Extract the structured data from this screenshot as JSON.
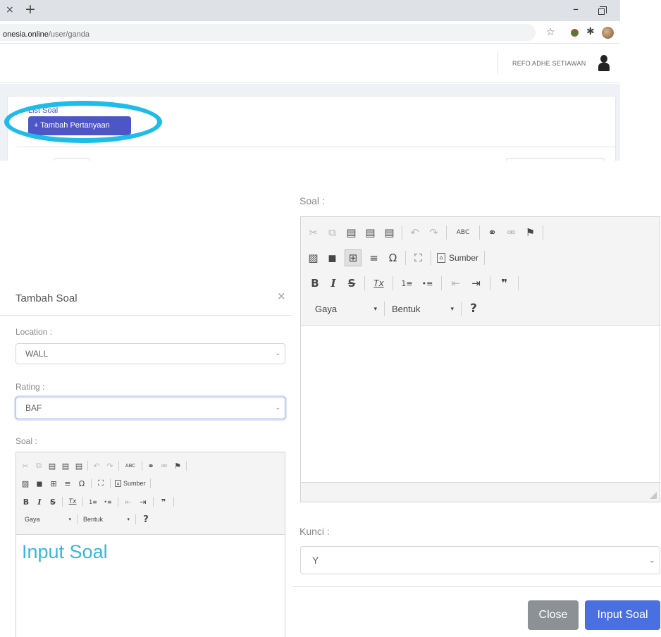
{
  "browser": {
    "url_host": "onesia.online",
    "url_path": "/user/ganda",
    "tab_close_glyph": "×",
    "new_tab_glyph": "+",
    "minimize_glyph": "–"
  },
  "header": {
    "username": "REFO ADHE SETIAWAN"
  },
  "list_card": {
    "title": "List Soal",
    "add_button_label": "+ Tambah Pertanyaan"
  },
  "modal": {
    "title": "Tambah Soal",
    "close_glyph": "×",
    "location_label": "Location :",
    "location_value": "WALL",
    "rating_label": "Rating :",
    "rating_value": "BAF",
    "soal_label": "Soal :",
    "editor_content": "Input Soal"
  },
  "editor_toolbar": {
    "source_label": "Sumber",
    "style_combo": "Gaya",
    "format_combo": "Bentuk",
    "icons": {
      "cut": "✂",
      "copy": "⧉",
      "paste": "📋",
      "paste_text": "📋",
      "paste_word": "📋",
      "undo": "↶",
      "redo": "↷",
      "spellcheck": "ABC",
      "link": "⚭",
      "unlink": "⚮",
      "anchor": "⚑",
      "image": "▨",
      "flash": "◼",
      "table": "⊞",
      "hr": "≡",
      "special_char": "Ω",
      "maximize": "⛶",
      "bold": "B",
      "italic": "I",
      "strike": "S",
      "remove_format": "Tx",
      "numbered_list": "1≡",
      "bulleted_list": "•≡",
      "outdent": "⇤",
      "indent": "⇥",
      "blockquote": "❞",
      "help": "?"
    }
  },
  "modal_right": {
    "soal_label": "Soal :",
    "kunci_label": "Kunci :",
    "kunci_value": "Y",
    "close_button": "Close",
    "submit_button": "Input Soal"
  },
  "colors": {
    "highlight_ring": "#1ebce8",
    "primary": "#4d55c7",
    "submit": "#4a6fe0",
    "close": "#8c9196",
    "editor_text": "#38b6dc"
  }
}
